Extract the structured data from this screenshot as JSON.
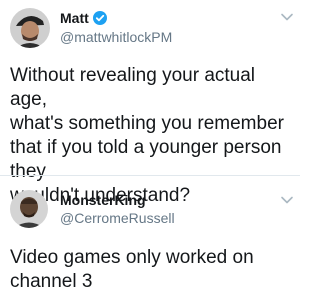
{
  "tweets": [
    {
      "display_name": "Matt",
      "handle": "@mattwhitlockPM",
      "verified": true,
      "text": "Without revealing your actual age,\nwhat's something you remember\nthat if you told a younger person they\nwouldn't understand?",
      "avatar_icon": "avatar-icon"
    },
    {
      "display_name": "MonsterKing",
      "handle": "@CerromeRussell",
      "verified": false,
      "text": "Video games only worked on\nchannel 3",
      "avatar_icon": "avatar-icon"
    }
  ],
  "colors": {
    "text": "#14171a",
    "secondary": "#657786",
    "verified": "#1da1f2",
    "divider": "#e1e8ed"
  },
  "icons": {
    "verified": "verified-badge-icon",
    "chevron": "chevron-down-icon"
  }
}
